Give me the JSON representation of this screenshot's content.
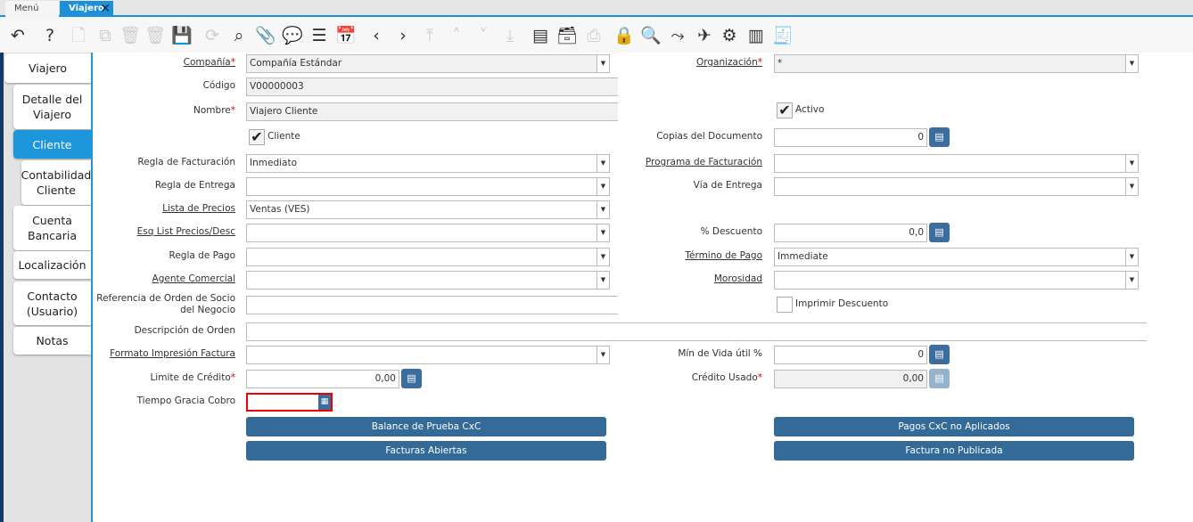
{
  "tabs": {
    "menu": "Menú (0)",
    "active": "Viajero"
  },
  "toolbar": [
    {
      "icon": "undo-icon",
      "g": "↶",
      "d": false
    },
    {
      "icon": "help-icon",
      "g": "?",
      "d": false
    },
    {
      "icon": "new-record-icon",
      "g": "🗋",
      "d": true
    },
    {
      "icon": "copy-record-icon",
      "g": "⧉",
      "d": true
    },
    {
      "icon": "delete-icon",
      "g": "🗑",
      "d": true
    },
    {
      "icon": "delete-selection-icon",
      "g": "🗑",
      "d": true
    },
    {
      "icon": "save-icon",
      "g": "💾",
      "d": false
    },
    {
      "icon": "refresh-icon",
      "g": "⟳",
      "d": true
    },
    {
      "icon": "search-icon",
      "g": "⌕",
      "d": false
    },
    {
      "icon": "attachment-icon",
      "g": "📎",
      "d": false
    },
    {
      "icon": "chat-icon",
      "g": "💬",
      "d": false
    },
    {
      "icon": "grid-toggle-icon",
      "g": "☰",
      "d": false
    },
    {
      "icon": "calendar-icon",
      "g": "📅",
      "d": true
    },
    {
      "icon": "previous-icon",
      "g": "‹",
      "d": false
    },
    {
      "icon": "next-icon",
      "g": "›",
      "d": false
    },
    {
      "icon": "first-record-icon",
      "g": "⤒",
      "d": true
    },
    {
      "icon": "previous-record-icon",
      "g": "˄",
      "d": true
    },
    {
      "icon": "next-record-icon",
      "g": "˅",
      "d": true
    },
    {
      "icon": "last-record-icon",
      "g": "⤓",
      "d": true
    },
    {
      "icon": "report-icon",
      "g": "▤",
      "d": false
    },
    {
      "icon": "archive-icon",
      "g": "🗃",
      "d": false
    },
    {
      "icon": "print-icon",
      "g": "⎙",
      "d": true
    },
    {
      "icon": "lock-icon",
      "g": "🔒",
      "d": false
    },
    {
      "icon": "zoom-across-icon",
      "g": "🔍",
      "d": false
    },
    {
      "icon": "workflow-icon",
      "g": "⤳",
      "d": false
    },
    {
      "icon": "send-icon",
      "g": "✈",
      "d": false
    },
    {
      "icon": "settings-icon",
      "g": "⚙",
      "d": false
    },
    {
      "icon": "barcode-search-icon",
      "g": "▥",
      "d": false
    },
    {
      "icon": "receipt-icon",
      "g": "🧾",
      "d": false
    }
  ],
  "side_tabs": [
    "Viajero",
    "Detalle del Viajero",
    "Cliente",
    "Contabilidad Cliente",
    "Cuenta Bancaria",
    "Localización",
    "Contacto (Usuario)",
    "Notas"
  ],
  "fields_left": [
    {
      "label": "Compañía",
      "req": true,
      "link": true,
      "value": "Compañía Estándar",
      "type": "combo",
      "ro": true
    },
    {
      "label": "Código",
      "value": "V00000003",
      "type": "text",
      "ro": true
    },
    {
      "label": "Nombre",
      "req": true,
      "value": "Viajero Cliente",
      "type": "text",
      "ro": true
    },
    {
      "label": "Regla de Facturación",
      "value": "Inmediato",
      "type": "combo"
    },
    {
      "label": "Regla de Entrega",
      "value": "",
      "type": "combo"
    },
    {
      "label": "Lista de Precios",
      "link": true,
      "value": "Ventas (VES)",
      "type": "combo"
    },
    {
      "label": "Esq List Precios/Desc",
      "link": true,
      "value": "",
      "type": "combo"
    },
    {
      "label": "Regla de Pago",
      "value": "",
      "type": "combo"
    },
    {
      "label": "Agente Comercial",
      "link": true,
      "value": "",
      "type": "combo"
    },
    {
      "label": "Referencia de Orden de Socio del Negocio",
      "value": "",
      "type": "text"
    },
    {
      "label": "Descripción de Orden",
      "value": "",
      "type": "wide"
    },
    {
      "label": "Formato Impresión Factura",
      "link": true,
      "value": "",
      "type": "combo"
    },
    {
      "label": "Limite de Crédito",
      "req": true,
      "value": "0,00",
      "type": "num"
    },
    {
      "label": "Tiempo Gracia Cobro",
      "value": "",
      "type": "date"
    }
  ],
  "fields_right": [
    {
      "label": "Organización",
      "req": true,
      "link": true,
      "value": "*",
      "type": "combo",
      "ro": true
    },
    {
      "label": "Copias del Documento",
      "value": "0",
      "type": "num"
    },
    {
      "label": "Programa de Facturación",
      "link": true,
      "value": "",
      "type": "combo"
    },
    {
      "label": "Vía de Entrega",
      "value": "",
      "type": "combo"
    },
    {
      "label": "% Descuento",
      "value": "0,0",
      "type": "num"
    },
    {
      "label": "Término de Pago",
      "link": true,
      "value": "Immediate",
      "type": "combo"
    },
    {
      "label": "Morosidad",
      "link": true,
      "value": "",
      "type": "combo"
    },
    {
      "label": "Mín de Vida útil %",
      "value": "0",
      "type": "num"
    },
    {
      "label": "Crédito Usado",
      "req": true,
      "value": "0,00",
      "type": "num",
      "ro": true
    }
  ],
  "checkboxes": [
    {
      "label": "Activo",
      "checked": true
    },
    {
      "label": "Cliente",
      "checked": true
    },
    {
      "label": "Imprimir Descuento",
      "checked": false
    }
  ],
  "buttons": [
    "Balance de Prueba CxC",
    "Pagos CxC no Aplicados",
    "Facturas Abiertas",
    "Factura no Publicada"
  ]
}
